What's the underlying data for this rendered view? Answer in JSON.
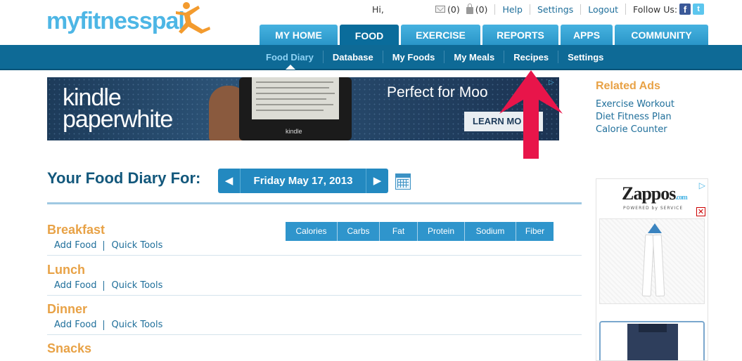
{
  "logo": {
    "text_my": "my",
    "text_fitness": "fitnesspal",
    "colors": {
      "text": "#4db6e5",
      "figure": "#f39b2e"
    }
  },
  "topbar": {
    "greeting": "Hi,",
    "mail_count": "(0)",
    "friend_count": "(0)",
    "links": [
      "Help",
      "Settings",
      "Logout"
    ],
    "follow_label": "Follow Us:",
    "facebook_glyph": "f",
    "twitter_glyph": "t"
  },
  "main_tabs": [
    {
      "label": "MY HOME",
      "active": false
    },
    {
      "label": "FOOD",
      "active": true
    },
    {
      "label": "EXERCISE",
      "active": false
    },
    {
      "label": "REPORTS",
      "active": false
    },
    {
      "label": "APPS",
      "active": false
    },
    {
      "label": "COMMUNITY",
      "active": false
    }
  ],
  "sub_nav": [
    {
      "label": "Food Diary",
      "active": true
    },
    {
      "label": "Database",
      "active": false
    },
    {
      "label": "My Foods",
      "active": false
    },
    {
      "label": "My Meals",
      "active": false
    },
    {
      "label": "Recipes",
      "active": false
    },
    {
      "label": "Settings",
      "active": false
    }
  ],
  "banner_ad": {
    "brand_line1": "kindle",
    "brand_line2": "paperwhite",
    "device_word": "kindle",
    "headline": "Perfect for Moo",
    "cta": "LEARN MO"
  },
  "related_ads": {
    "title": "Related Ads",
    "links": [
      "Exercise Workout",
      "Diet Fitness Plan",
      "Calorie Counter"
    ]
  },
  "diary": {
    "title": "Your Food Diary For:",
    "date": "Friday May 17, 2013",
    "prev_glyph": "◀",
    "next_glyph": "▶",
    "columns": [
      "Calories",
      "Carbs",
      "Fat",
      "Protein",
      "Sodium",
      "Fiber"
    ],
    "meals": [
      {
        "name": "Breakfast",
        "add_food": "Add Food",
        "quick_tools": "Quick Tools"
      },
      {
        "name": "Lunch",
        "add_food": "Add Food",
        "quick_tools": "Quick Tools"
      },
      {
        "name": "Dinner",
        "add_food": "Add Food",
        "quick_tools": "Quick Tools"
      },
      {
        "name": "Snacks"
      }
    ]
  },
  "side_ad": {
    "brand": "Zappos",
    "brand_suffix": ".com",
    "tagline": "POWERED by SERVICE",
    "close_glyph": "✕",
    "adchoice_glyph": "▷"
  },
  "colors": {
    "accent_blue": "#2389c0",
    "nav_dark": "#0e6a96",
    "meal_orange": "#e8a246",
    "arrow_red": "#e8154a"
  }
}
